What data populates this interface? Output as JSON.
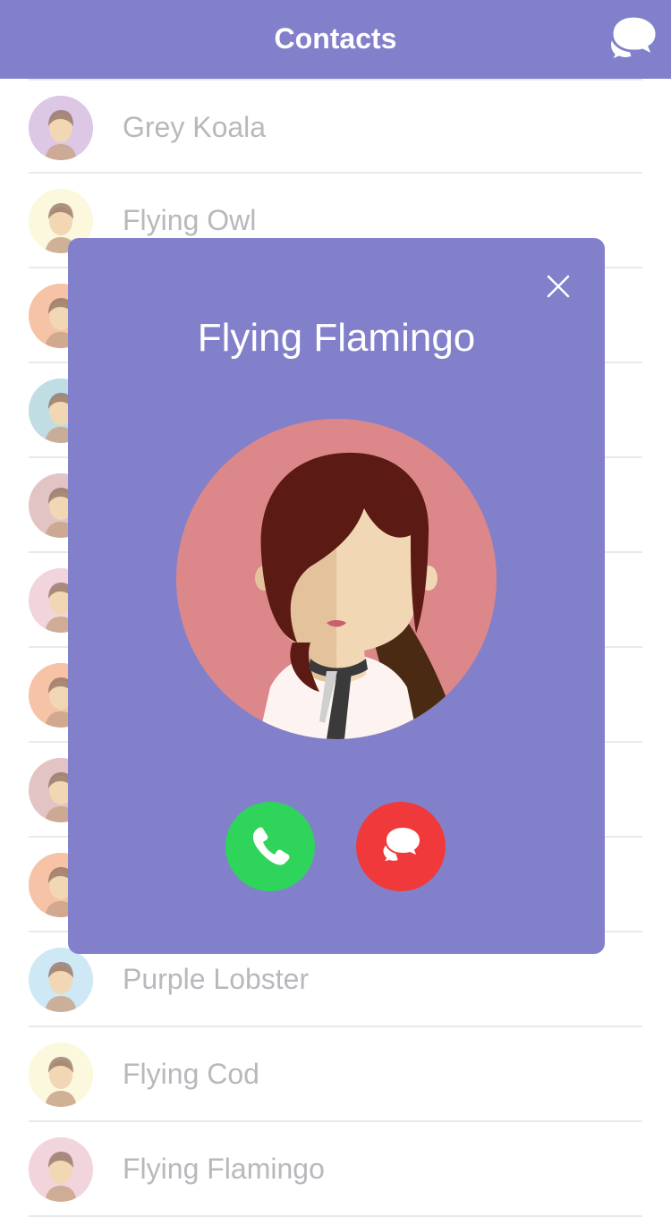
{
  "header": {
    "title": "Contacts",
    "background": "#8280cb",
    "action_icon": "chat-bubbles-icon"
  },
  "contacts": [
    {
      "name": "Grey Koala",
      "avatar_bg": "#dcc7e4"
    },
    {
      "name": "Flying Owl",
      "avatar_bg": "#fbf8dd"
    },
    {
      "name": "",
      "avatar_bg": "#f6c3a6"
    },
    {
      "name": "",
      "avatar_bg": "#bfdde3"
    },
    {
      "name": "",
      "avatar_bg": "#e3c4c5"
    },
    {
      "name": "",
      "avatar_bg": "#f1d4dc"
    },
    {
      "name": "",
      "avatar_bg": "#f6c3a6"
    },
    {
      "name": "",
      "avatar_bg": "#e3c4c5"
    },
    {
      "name": "",
      "avatar_bg": "#f6c3a6"
    },
    {
      "name": "Purple Lobster",
      "avatar_bg": "#cfe8f6"
    },
    {
      "name": "Flying Cod",
      "avatar_bg": "#fbf8dd"
    },
    {
      "name": "Flying Flamingo",
      "avatar_bg": "#f1d4dc"
    }
  ],
  "call_modal": {
    "contact_name": "Flying Flamingo",
    "avatar_bg": "#dc878a",
    "close_icon": "close-icon",
    "accept_icon": "phone-icon",
    "accept_color": "#2fd45a",
    "message_icon": "chat-bubbles-icon",
    "message_color": "#f0393b"
  }
}
